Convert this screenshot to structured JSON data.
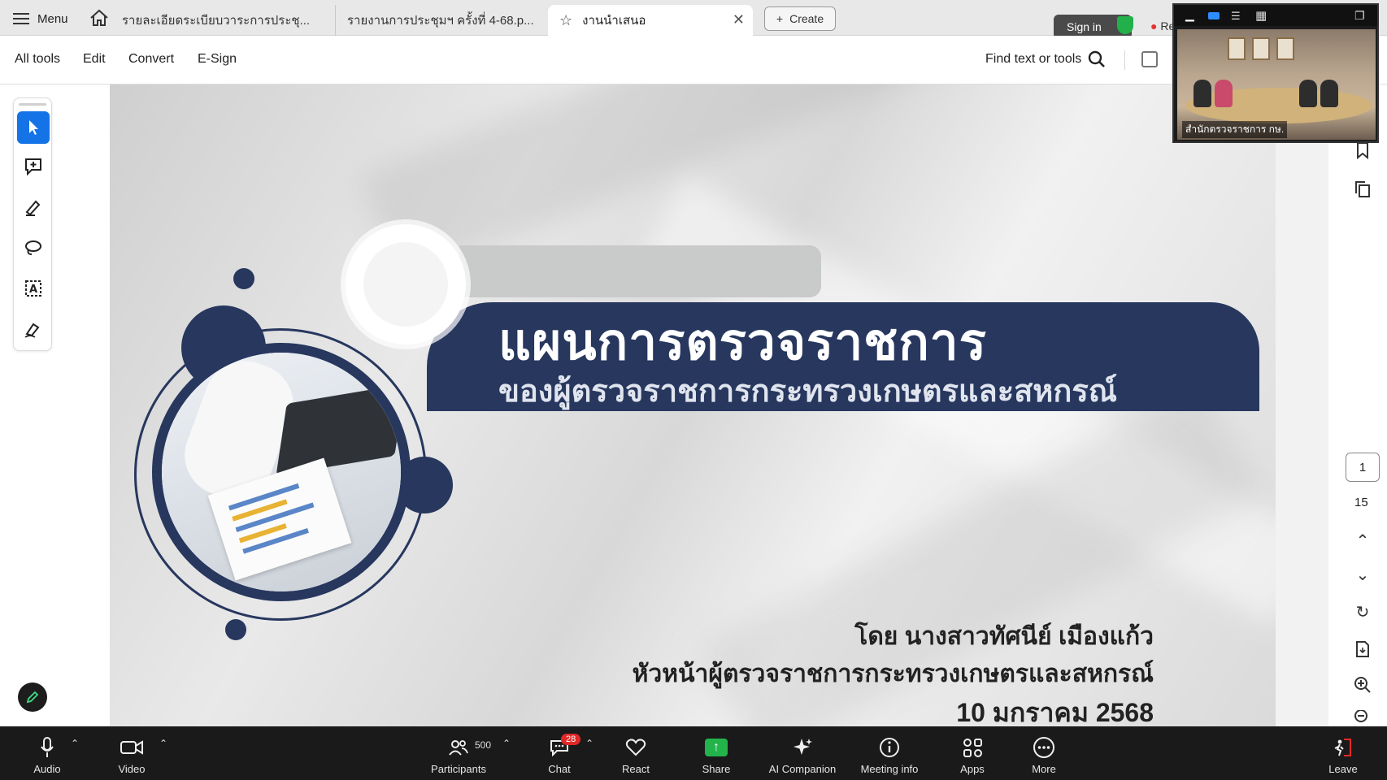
{
  "tabbar": {
    "menu_label": "Menu",
    "tabs": [
      {
        "label": "รายละเอียดระเบียบวาระการประชุ..."
      },
      {
        "label": "รายงานการประชุมฯ ครั้งที่ 4-68.p..."
      },
      {
        "label": "งานนำเสนอ"
      }
    ],
    "create_label": "Create",
    "signin_label": "Sign in",
    "record_label": "Re"
  },
  "toolbar": {
    "items": [
      "All tools",
      "Edit",
      "Convert",
      "E-Sign"
    ],
    "find_label": "Find text or tools"
  },
  "slide": {
    "title_main": "แผนการตรวจราชการ",
    "title_sub": "ของผู้ตรวจราชการกระทรวงเกษตรและสหกรณ์",
    "byline_1": "โดย นางสาวทัศนีย์ เมืองแก้ว",
    "byline_2": "หัวหน้าผู้ตรวจราชการกระทรวงเกษตรและสหกรณ์",
    "byline_3": "10 มกราคม 2568"
  },
  "pager": {
    "current_page": "1",
    "total_pages": "15"
  },
  "video": {
    "name_label": "สำนักตรวจราชการ กษ."
  },
  "meeting_bar": {
    "audio": "Audio",
    "video": "Video",
    "participants": "Participants",
    "participants_count": "500",
    "chat": "Chat",
    "chat_badge": "28",
    "react": "React",
    "share": "Share",
    "ai_companion": "AI Companion",
    "meeting_info": "Meeting info",
    "apps": "Apps",
    "more": "More",
    "leave": "Leave"
  },
  "colors": {
    "banner_navy": "#27375e",
    "active_tool": "#1473e6",
    "share_green": "#23b34b",
    "badge_red": "#e02828"
  }
}
